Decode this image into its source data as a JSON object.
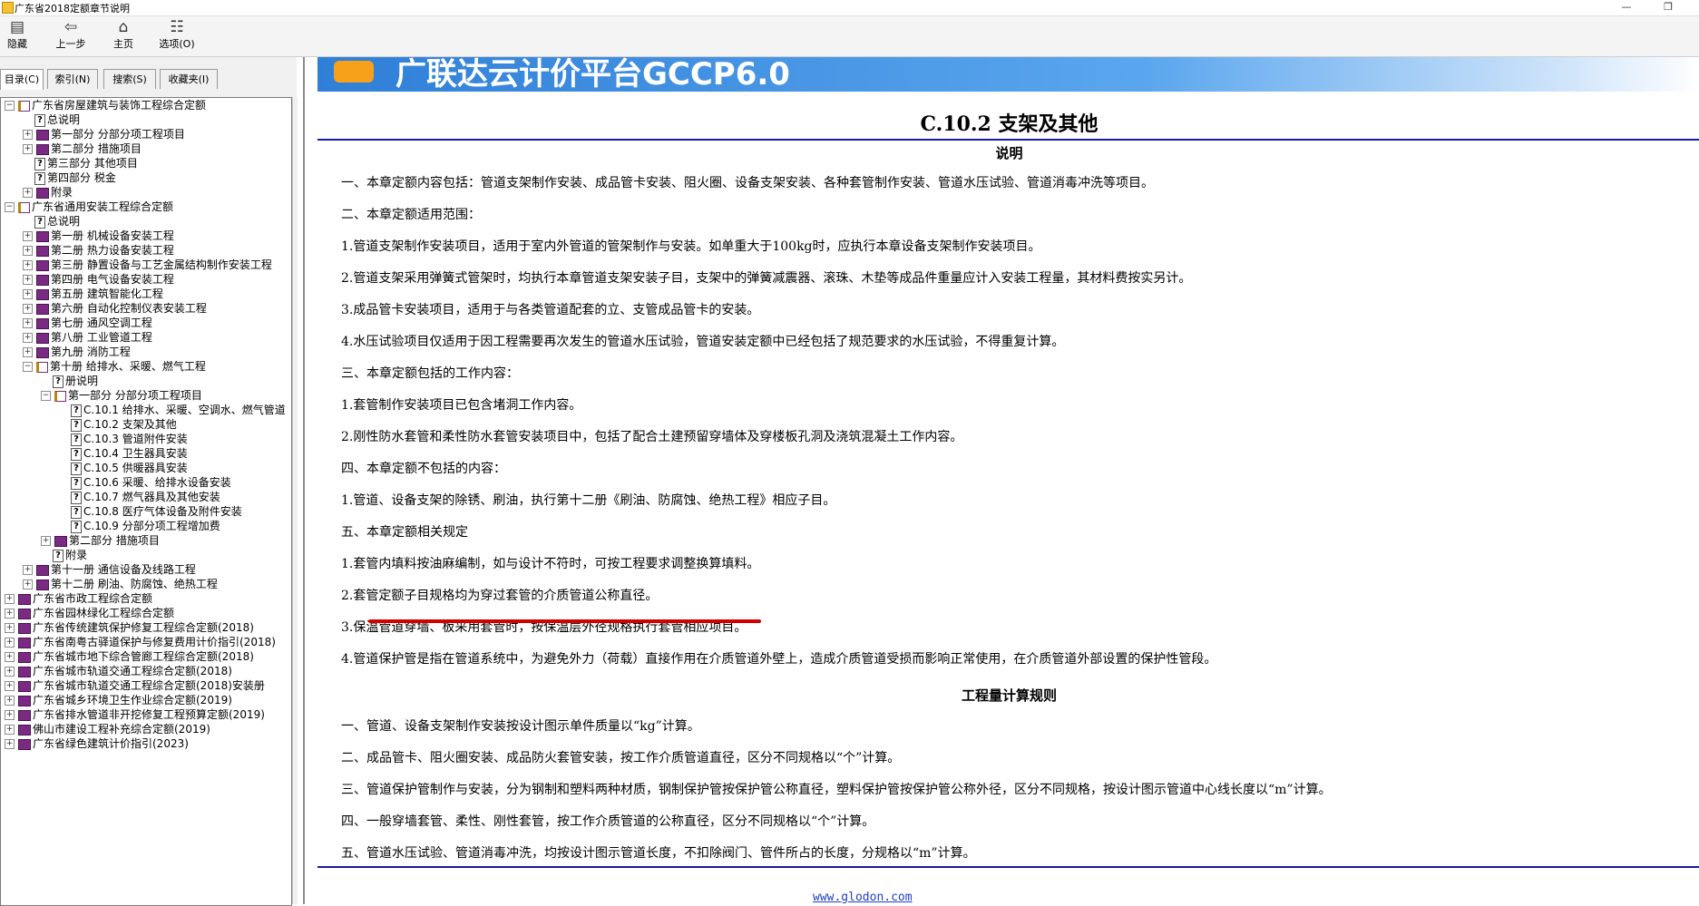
{
  "window": {
    "title": "广东省2018定额章节说明",
    "minimize": "—",
    "restore": "❐"
  },
  "toolbar": {
    "hide": {
      "label": "隐藏",
      "icon": "hide-pane-icon"
    },
    "back": {
      "label": "上一步",
      "icon": "back-arrow-icon"
    },
    "home": {
      "label": "主页",
      "icon": "home-icon"
    },
    "options": {
      "label": "选项(O)",
      "icon": "options-icon"
    }
  },
  "sidebar": {
    "tabs": [
      "目录(C)",
      "索引(N)",
      "搜索(S)",
      "收藏夹(I)"
    ],
    "tree": [
      {
        "depth": 0,
        "toggle": "⊟",
        "icon": "open",
        "label": "广东省房屋建筑与装饰工程综合定额"
      },
      {
        "depth": 1,
        "toggle": "",
        "icon": "page",
        "label": "总说明"
      },
      {
        "depth": 1,
        "toggle": "⊞",
        "icon": "book",
        "label": "第一部分 分部分项工程项目"
      },
      {
        "depth": 1,
        "toggle": "⊞",
        "icon": "book",
        "label": "第二部分 措施项目"
      },
      {
        "depth": 1,
        "toggle": "",
        "icon": "page",
        "label": "第三部分 其他项目"
      },
      {
        "depth": 1,
        "toggle": "",
        "icon": "page",
        "label": "第四部分 税金"
      },
      {
        "depth": 1,
        "toggle": "⊞",
        "icon": "book",
        "label": "附录"
      },
      {
        "depth": 0,
        "toggle": "⊟",
        "icon": "open",
        "label": "广东省通用安装工程综合定额"
      },
      {
        "depth": 1,
        "toggle": "",
        "icon": "page",
        "label": "总说明"
      },
      {
        "depth": 1,
        "toggle": "⊞",
        "icon": "book",
        "label": "第一册 机械设备安装工程"
      },
      {
        "depth": 1,
        "toggle": "⊞",
        "icon": "book",
        "label": "第二册 热力设备安装工程"
      },
      {
        "depth": 1,
        "toggle": "⊞",
        "icon": "book",
        "label": "第三册 静置设备与工艺金属结构制作安装工程"
      },
      {
        "depth": 1,
        "toggle": "⊞",
        "icon": "book",
        "label": "第四册 电气设备安装工程"
      },
      {
        "depth": 1,
        "toggle": "⊞",
        "icon": "book",
        "label": "第五册 建筑智能化工程"
      },
      {
        "depth": 1,
        "toggle": "⊞",
        "icon": "book",
        "label": "第六册 自动化控制仪表安装工程"
      },
      {
        "depth": 1,
        "toggle": "⊞",
        "icon": "book",
        "label": "第七册 通风空调工程"
      },
      {
        "depth": 1,
        "toggle": "⊞",
        "icon": "book",
        "label": "第八册 工业管道工程"
      },
      {
        "depth": 1,
        "toggle": "⊞",
        "icon": "book",
        "label": "第九册 消防工程"
      },
      {
        "depth": 1,
        "toggle": "⊟",
        "icon": "open",
        "label": "第十册 给排水、采暖、燃气工程"
      },
      {
        "depth": 2,
        "toggle": "",
        "icon": "page",
        "label": "册说明"
      },
      {
        "depth": 2,
        "toggle": "⊟",
        "icon": "open",
        "label": "第一部分 分部分项工程项目"
      },
      {
        "depth": 3,
        "toggle": "",
        "icon": "page",
        "label": "C.10.1 给排水、采暖、空调水、燃气管道"
      },
      {
        "depth": 3,
        "toggle": "",
        "icon": "page",
        "label": "C.10.2 支架及其他"
      },
      {
        "depth": 3,
        "toggle": "",
        "icon": "page",
        "label": "C.10.3 管道附件安装"
      },
      {
        "depth": 3,
        "toggle": "",
        "icon": "page",
        "label": "C.10.4 卫生器具安装"
      },
      {
        "depth": 3,
        "toggle": "",
        "icon": "page",
        "label": "C.10.5 供暖器具安装"
      },
      {
        "depth": 3,
        "toggle": "",
        "icon": "page",
        "label": "C.10.6 采暖、给排水设备安装"
      },
      {
        "depth": 3,
        "toggle": "",
        "icon": "page",
        "label": "C.10.7 燃气器具及其他安装"
      },
      {
        "depth": 3,
        "toggle": "",
        "icon": "page",
        "label": "C.10.8 医疗气体设备及附件安装"
      },
      {
        "depth": 3,
        "toggle": "",
        "icon": "page",
        "label": "C.10.9 分部分项工程增加费"
      },
      {
        "depth": 2,
        "toggle": "⊞",
        "icon": "book",
        "label": "第二部分 措施项目"
      },
      {
        "depth": 2,
        "toggle": "",
        "icon": "page",
        "label": "附录"
      },
      {
        "depth": 1,
        "toggle": "⊞",
        "icon": "book",
        "label": "第十一册 通信设备及线路工程"
      },
      {
        "depth": 1,
        "toggle": "⊞",
        "icon": "book",
        "label": "第十二册 刷油、防腐蚀、绝热工程"
      },
      {
        "depth": 0,
        "toggle": "⊞",
        "icon": "book",
        "label": "广东省市政工程综合定额"
      },
      {
        "depth": 0,
        "toggle": "⊞",
        "icon": "book",
        "label": "广东省园林绿化工程综合定额"
      },
      {
        "depth": 0,
        "toggle": "⊞",
        "icon": "book",
        "label": "广东省传统建筑保护修复工程综合定额(2018)"
      },
      {
        "depth": 0,
        "toggle": "⊞",
        "icon": "book",
        "label": "广东省南粤古驿道保护与修复费用计价指引(2018)"
      },
      {
        "depth": 0,
        "toggle": "⊞",
        "icon": "book",
        "label": "广东省城市地下综合管廊工程综合定额(2018)"
      },
      {
        "depth": 0,
        "toggle": "⊞",
        "icon": "book",
        "label": "广东省城市轨道交通工程综合定额(2018)"
      },
      {
        "depth": 0,
        "toggle": "⊞",
        "icon": "book",
        "label": "广东省城市轨道交通工程综合定额(2018)安装册"
      },
      {
        "depth": 0,
        "toggle": "⊞",
        "icon": "book",
        "label": "广东省城乡环境卫生作业综合定额(2019)"
      },
      {
        "depth": 0,
        "toggle": "⊞",
        "icon": "book",
        "label": "广东省排水管道非开挖修复工程预算定额(2019)"
      },
      {
        "depth": 0,
        "toggle": "⊞",
        "icon": "book",
        "label": "佛山市建设工程补充综合定额(2019)"
      },
      {
        "depth": 0,
        "toggle": "⊞",
        "icon": "book",
        "label": "广东省绿色建筑计价指引(2023)"
      }
    ]
  },
  "content": {
    "banner_text": "广联达云计价平台GCCP6.0",
    "title": "C.10.2 支架及其他",
    "section1": "说明",
    "section2": "工程量计算规则",
    "paragraphs": [
      "一、本章定额内容包括：管道支架制作安装、成品管卡安装、阻火圈、设备支架安装、各种套管制作安装、管道水压试验、管道消毒冲洗等项目。",
      "二、本章定额适用范围：",
      "1.管道支架制作安装项目，适用于室内外管道的管架制作与安装。如单重大于100kg时，应执行本章设备支架制作安装项目。",
      "2.管道支架采用弹簧式管架时，均执行本章管道支架安装子目，支架中的弹簧减震器、滚珠、木垫等成品件重量应计入安装工程量，其材料费按实另计。",
      "3.成品管卡安装项目，适用于与各类管道配套的立、支管成品管卡的安装。",
      "4.水压试验项目仅适用于因工程需要再次发生的管道水压试验，管道安装定额中已经包括了规范要求的水压试验，不得重复计算。",
      "三、本章定额包括的工作内容：",
      "1.套管制作安装项目已包含堵洞工作内容。",
      "2.刚性防水套管和柔性防水套管安装项目中，包括了配合土建预留穿墙体及穿楼板孔洞及浇筑混凝土工作内容。",
      "四、本章定额不包括的内容：",
      "1.管道、设备支架的除锈、刷油，执行第十二册《刷油、防腐蚀、绝热工程》相应子目。",
      "五、本章定额相关规定",
      "1.套管内填料按油麻编制，如与设计不符时，可按工程要求调整换算填料。",
      "2.套管定额子目规格均为穿过套管的介质管道公称直径。",
      "3.保温管道穿墙、板采用套管时，按保温层外径规格执行套管相应项目。",
      "4.管道保护管是指在管道系统中，为避免外力（荷载）直接作用在介质管道外壁上，造成介质管道受损而影响正常使用，在介质管道外部设置的保护性管段。"
    ],
    "rules": [
      "一、管道、设备支架制作安装按设计图示单件质量以“kg”计算。",
      "二、成品管卡、阻火圈安装、成品防火套管安装，按工作介质管道直径，区分不同规格以“个”计算。",
      "三、管道保护管制作与安装，分为钢制和塑料两种材质，钢制保护管按保护管公称直径，塑料保护管按保护管公称外径，区分不同规格，按设计图示管道中心线长度以“m”计算。",
      "四、一般穿墙套管、柔性、刚性套管，按工作介质管道的公称直径，区分不同规格以“个”计算。",
      "五、管道水压试验、管道消毒冲洗，均按设计图示管道长度，不扣除阀门、管件所占的长度，分规格以“m”计算。"
    ],
    "footer_link": "www.glodon.com",
    "accent": "#1a1a9e",
    "highlight": "#d40000"
  }
}
